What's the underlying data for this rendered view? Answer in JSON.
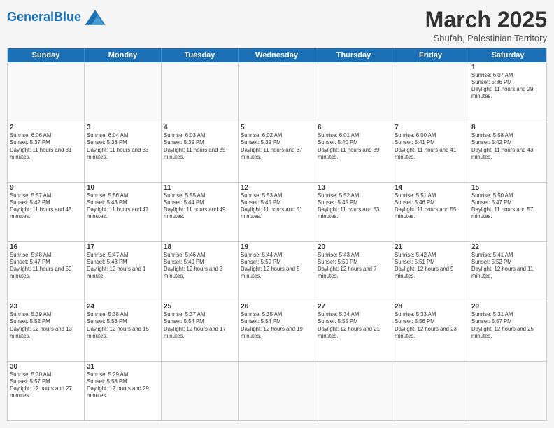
{
  "logo": {
    "text_general": "General",
    "text_blue": "Blue"
  },
  "header": {
    "month": "March 2025",
    "location": "Shufah, Palestinian Territory"
  },
  "day_headers": [
    "Sunday",
    "Monday",
    "Tuesday",
    "Wednesday",
    "Thursday",
    "Friday",
    "Saturday"
  ],
  "weeks": [
    [
      {
        "day": "",
        "info": ""
      },
      {
        "day": "",
        "info": ""
      },
      {
        "day": "",
        "info": ""
      },
      {
        "day": "",
        "info": ""
      },
      {
        "day": "",
        "info": ""
      },
      {
        "day": "",
        "info": ""
      },
      {
        "day": "1",
        "info": "Sunrise: 6:07 AM\nSunset: 5:36 PM\nDaylight: 11 hours and 29 minutes."
      }
    ],
    [
      {
        "day": "2",
        "info": "Sunrise: 6:06 AM\nSunset: 5:37 PM\nDaylight: 11 hours and 31 minutes."
      },
      {
        "day": "3",
        "info": "Sunrise: 6:04 AM\nSunset: 5:38 PM\nDaylight: 11 hours and 33 minutes."
      },
      {
        "day": "4",
        "info": "Sunrise: 6:03 AM\nSunset: 5:39 PM\nDaylight: 11 hours and 35 minutes."
      },
      {
        "day": "5",
        "info": "Sunrise: 6:02 AM\nSunset: 5:39 PM\nDaylight: 11 hours and 37 minutes."
      },
      {
        "day": "6",
        "info": "Sunrise: 6:01 AM\nSunset: 5:40 PM\nDaylight: 11 hours and 39 minutes."
      },
      {
        "day": "7",
        "info": "Sunrise: 6:00 AM\nSunset: 5:41 PM\nDaylight: 11 hours and 41 minutes."
      },
      {
        "day": "8",
        "info": "Sunrise: 5:58 AM\nSunset: 5:42 PM\nDaylight: 11 hours and 43 minutes."
      }
    ],
    [
      {
        "day": "9",
        "info": "Sunrise: 5:57 AM\nSunset: 5:42 PM\nDaylight: 11 hours and 45 minutes."
      },
      {
        "day": "10",
        "info": "Sunrise: 5:56 AM\nSunset: 5:43 PM\nDaylight: 11 hours and 47 minutes."
      },
      {
        "day": "11",
        "info": "Sunrise: 5:55 AM\nSunset: 5:44 PM\nDaylight: 11 hours and 49 minutes."
      },
      {
        "day": "12",
        "info": "Sunrise: 5:53 AM\nSunset: 5:45 PM\nDaylight: 11 hours and 51 minutes."
      },
      {
        "day": "13",
        "info": "Sunrise: 5:52 AM\nSunset: 5:45 PM\nDaylight: 11 hours and 53 minutes."
      },
      {
        "day": "14",
        "info": "Sunrise: 5:51 AM\nSunset: 5:46 PM\nDaylight: 11 hours and 55 minutes."
      },
      {
        "day": "15",
        "info": "Sunrise: 5:50 AM\nSunset: 5:47 PM\nDaylight: 11 hours and 57 minutes."
      }
    ],
    [
      {
        "day": "16",
        "info": "Sunrise: 5:48 AM\nSunset: 5:47 PM\nDaylight: 11 hours and 59 minutes."
      },
      {
        "day": "17",
        "info": "Sunrise: 5:47 AM\nSunset: 5:48 PM\nDaylight: 12 hours and 1 minute."
      },
      {
        "day": "18",
        "info": "Sunrise: 5:46 AM\nSunset: 5:49 PM\nDaylight: 12 hours and 3 minutes."
      },
      {
        "day": "19",
        "info": "Sunrise: 5:44 AM\nSunset: 5:50 PM\nDaylight: 12 hours and 5 minutes."
      },
      {
        "day": "20",
        "info": "Sunrise: 5:43 AM\nSunset: 5:50 PM\nDaylight: 12 hours and 7 minutes."
      },
      {
        "day": "21",
        "info": "Sunrise: 5:42 AM\nSunset: 5:51 PM\nDaylight: 12 hours and 9 minutes."
      },
      {
        "day": "22",
        "info": "Sunrise: 5:41 AM\nSunset: 5:52 PM\nDaylight: 12 hours and 11 minutes."
      }
    ],
    [
      {
        "day": "23",
        "info": "Sunrise: 5:39 AM\nSunset: 5:52 PM\nDaylight: 12 hours and 13 minutes."
      },
      {
        "day": "24",
        "info": "Sunrise: 5:38 AM\nSunset: 5:53 PM\nDaylight: 12 hours and 15 minutes."
      },
      {
        "day": "25",
        "info": "Sunrise: 5:37 AM\nSunset: 5:54 PM\nDaylight: 12 hours and 17 minutes."
      },
      {
        "day": "26",
        "info": "Sunrise: 5:35 AM\nSunset: 5:54 PM\nDaylight: 12 hours and 19 minutes."
      },
      {
        "day": "27",
        "info": "Sunrise: 5:34 AM\nSunset: 5:55 PM\nDaylight: 12 hours and 21 minutes."
      },
      {
        "day": "28",
        "info": "Sunrise: 5:33 AM\nSunset: 5:56 PM\nDaylight: 12 hours and 23 minutes."
      },
      {
        "day": "29",
        "info": "Sunrise: 5:31 AM\nSunset: 5:57 PM\nDaylight: 12 hours and 25 minutes."
      }
    ],
    [
      {
        "day": "30",
        "info": "Sunrise: 5:30 AM\nSunset: 5:57 PM\nDaylight: 12 hours and 27 minutes."
      },
      {
        "day": "31",
        "info": "Sunrise: 5:29 AM\nSunset: 5:58 PM\nDaylight: 12 hours and 29 minutes."
      },
      {
        "day": "",
        "info": ""
      },
      {
        "day": "",
        "info": ""
      },
      {
        "day": "",
        "info": ""
      },
      {
        "day": "",
        "info": ""
      },
      {
        "day": "",
        "info": ""
      }
    ]
  ]
}
